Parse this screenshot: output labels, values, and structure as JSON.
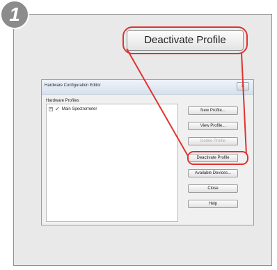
{
  "step": {
    "number": "1"
  },
  "callout": {
    "label": "Deactivate Profile"
  },
  "dialog": {
    "title": "Hardware Configuration Editor",
    "close_label": "×",
    "group_label": "Hardware Profiles",
    "tree": {
      "items": [
        {
          "label": "Main Spectrometer",
          "expand": "+"
        }
      ]
    },
    "buttons": [
      {
        "label": "New Profile...",
        "enabled": true
      },
      {
        "label": "View Profile...",
        "enabled": true
      },
      {
        "label": "Delete Profile",
        "enabled": false
      },
      {
        "label": "Deactivate Profile",
        "enabled": true
      },
      {
        "label": "Available Devices...",
        "enabled": true
      },
      {
        "label": "Close",
        "enabled": true
      },
      {
        "label": "Help",
        "enabled": true
      }
    ]
  },
  "colors": {
    "highlight": "#e0322f",
    "check": "#2e9c2e",
    "badge": "#8c8c8c"
  },
  "icons": {
    "check": "checkmark-icon",
    "expand": "plus-box-icon"
  }
}
